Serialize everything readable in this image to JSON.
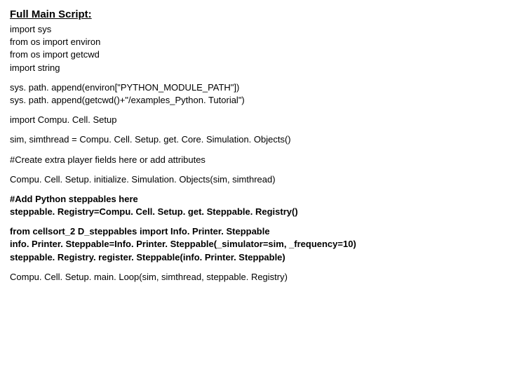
{
  "title": "Full Main Script:",
  "lines": {
    "l1": "import sys",
    "l2": "from os import environ",
    "l3": "from os import getcwd",
    "l4": "import string",
    "l5": "sys. path. append(environ[\"PYTHON_MODULE_PATH\"])",
    "l6": "sys. path. append(getcwd()+\"/examples_Python. Tutorial\")",
    "l7": "import Compu. Cell. Setup",
    "l8": "sim, simthread = Compu. Cell. Setup. get. Core. Simulation. Objects()",
    "l9": "#Create extra player fields here or add attributes",
    "l10": "Compu. Cell. Setup. initialize. Simulation. Objects(sim, simthread)",
    "l11": "#Add Python steppables here",
    "l12": "steppable. Registry=Compu. Cell. Setup. get. Steppable. Registry()",
    "l13": "from cellsort_2 D_steppables import Info. Printer. Steppable",
    "l14": "info. Printer. Steppable=Info. Printer. Steppable(_simulator=sim, _frequency=10)",
    "l15": "steppable. Registry. register. Steppable(info. Printer. Steppable)",
    "l16": "Compu. Cell. Setup. main. Loop(sim, simthread, steppable. Registry)"
  }
}
